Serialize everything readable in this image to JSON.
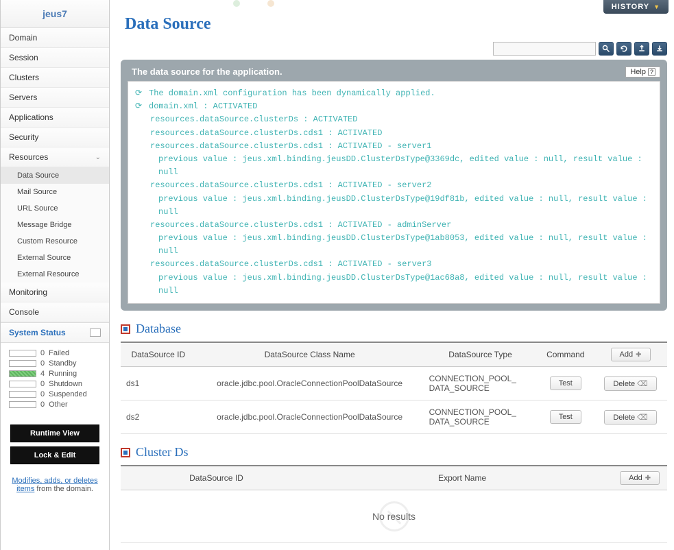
{
  "sidebar": {
    "brand": "jeus7",
    "nav": [
      {
        "label": "Domain"
      },
      {
        "label": "Session"
      },
      {
        "label": "Clusters"
      },
      {
        "label": "Servers"
      },
      {
        "label": "Applications"
      },
      {
        "label": "Security"
      },
      {
        "label": "Resources",
        "expanded": true,
        "children": [
          {
            "label": "Data Source",
            "active": true
          },
          {
            "label": "Mail Source"
          },
          {
            "label": "URL Source"
          },
          {
            "label": "Message Bridge"
          },
          {
            "label": "Custom Resource"
          },
          {
            "label": "External Source"
          },
          {
            "label": "External Resource"
          }
        ]
      },
      {
        "label": "Monitoring"
      },
      {
        "label": "Console"
      }
    ],
    "systemStatus": {
      "title": "System Status",
      "items": [
        {
          "count": 0,
          "label": "Failed"
        },
        {
          "count": 0,
          "label": "Standby"
        },
        {
          "count": 4,
          "label": "Running",
          "filled": true
        },
        {
          "count": 0,
          "label": "Shutdown"
        },
        {
          "count": 0,
          "label": "Suspended"
        },
        {
          "count": 0,
          "label": "Other"
        }
      ]
    },
    "buttons": {
      "runtime": "Runtime View",
      "lockEdit": "Lock & Edit"
    },
    "footer": {
      "link": "Modifies, adds, or deletes items",
      "rest": " from the domain."
    }
  },
  "header": {
    "history": "HISTORY",
    "pageTitle": "Data Source",
    "searchPlaceholder": ""
  },
  "infoBox": {
    "title": "The data source for the application.",
    "help": "Help",
    "log": [
      {
        "icon": true,
        "text": "The domain.xml configuration has been dynamically applied."
      },
      {
        "icon": true,
        "text": "domain.xml : ACTIVATED"
      },
      {
        "indent": 1,
        "text": "resources.dataSource.clusterDs : ACTIVATED"
      },
      {
        "indent": 1,
        "text": "resources.dataSource.clusterDs.cds1 : ACTIVATED"
      },
      {
        "indent": 1,
        "text": "resources.dataSource.clusterDs.cds1 : ACTIVATED - server1"
      },
      {
        "indent": 2,
        "text": "previous value : jeus.xml.binding.jeusDD.ClusterDsType@3369dc, edited value : null, result value : null"
      },
      {
        "indent": 1,
        "text": "resources.dataSource.clusterDs.cds1 : ACTIVATED - server2"
      },
      {
        "indent": 2,
        "text": "previous value : jeus.xml.binding.jeusDD.ClusterDsType@19df81b, edited value : null, result value : null"
      },
      {
        "indent": 1,
        "text": "resources.dataSource.clusterDs.cds1 : ACTIVATED - adminServer"
      },
      {
        "indent": 2,
        "text": "previous value : jeus.xml.binding.jeusDD.ClusterDsType@1ab8053, edited value : null, result value : null"
      },
      {
        "indent": 1,
        "text": "resources.dataSource.clusterDs.cds1 : ACTIVATED - server3"
      },
      {
        "indent": 2,
        "text": "previous value : jeus.xml.binding.jeusDD.ClusterDsType@1ac68a8, edited value : null, result value : null"
      }
    ]
  },
  "databaseSection": {
    "title": "Database",
    "columns": {
      "id": "DataSource ID",
      "className": "DataSource Class Name",
      "type": "DataSource Type",
      "command": "Command",
      "add": "Add"
    },
    "rows": [
      {
        "id": "ds1",
        "className": "oracle.jdbc.pool.OracleConnectionPoolDataSource",
        "type": "CONNECTION_POOL_DATA_SOURCE",
        "command": "Test",
        "action": "Delete"
      },
      {
        "id": "ds2",
        "className": "oracle.jdbc.pool.OracleConnectionPoolDataSource",
        "type": "CONNECTION_POOL_DATA_SOURCE",
        "command": "Test",
        "action": "Delete"
      }
    ]
  },
  "clusterSection": {
    "title": "Cluster Ds",
    "columns": {
      "id": "DataSource ID",
      "exportName": "Export Name",
      "add": "Add"
    },
    "noResults": "No results"
  }
}
